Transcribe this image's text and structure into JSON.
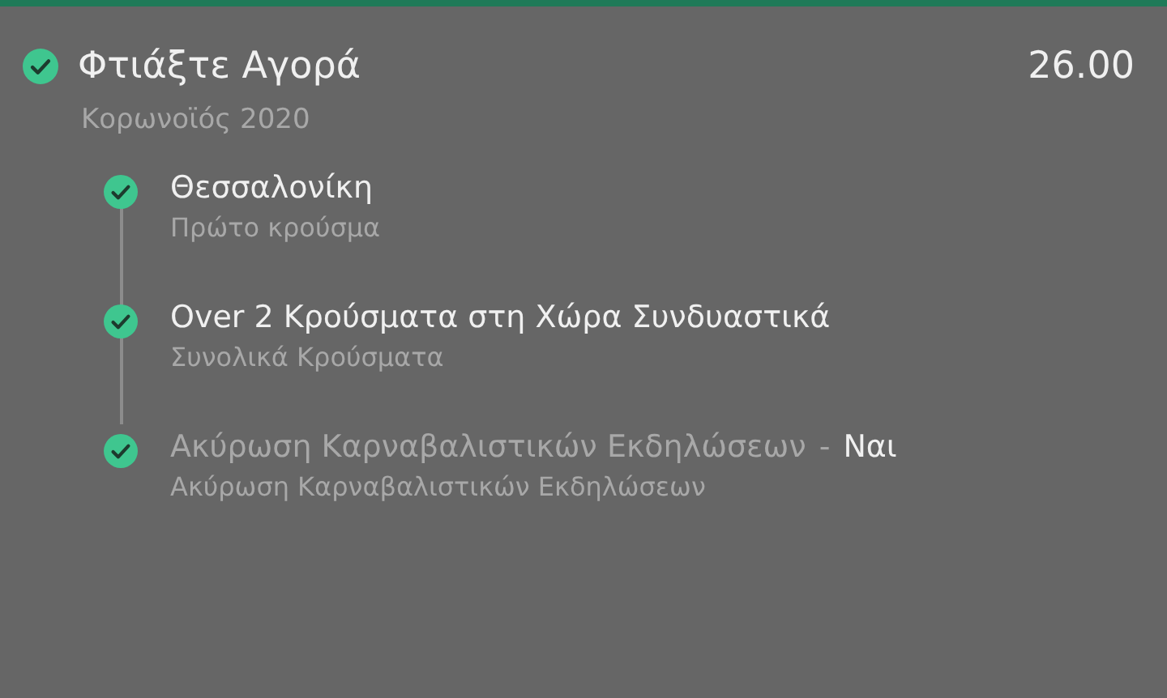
{
  "bet": {
    "title": "Φτιάξτε Αγορά",
    "odds": "26.00",
    "subtitle": "Κορωνοϊός 2020",
    "checked": true
  },
  "legs": [
    {
      "kind": "plain",
      "title": "Θεσσαλονίκη",
      "market": "Πρώτο κρούσμα",
      "checked": true
    },
    {
      "kind": "plain",
      "title": "Over 2 Κρούσματα στη Χώρα Συνδυαστικά",
      "market": "Συνολικά Κρούσματα",
      "checked": true
    },
    {
      "kind": "with-selection",
      "title": "Ακύρωση Καρναβαλιστικών Εκδηλώσεων",
      "separator": "-",
      "selection": "Ναι",
      "market": "Ακύρωση Καρναβαλιστικών Εκδηλώσεων",
      "checked": true
    }
  ]
}
